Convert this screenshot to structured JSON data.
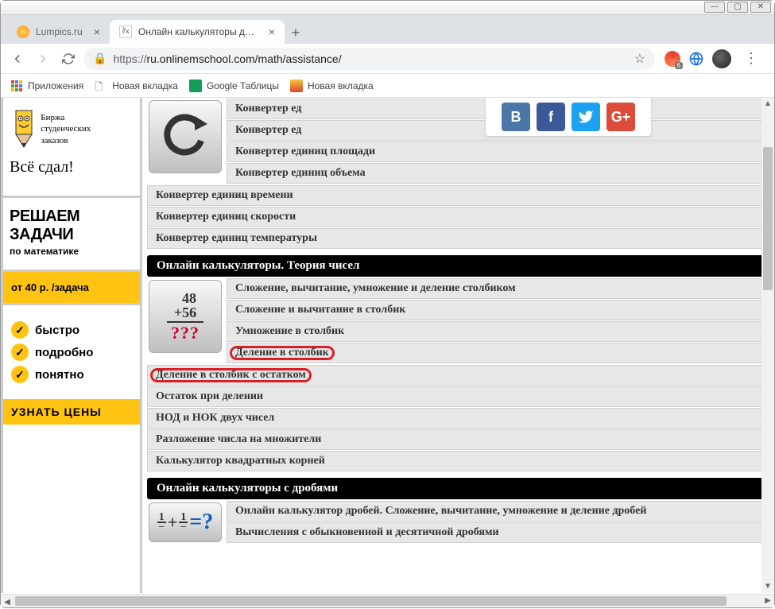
{
  "window": {
    "controls": {
      "min": "—",
      "max": "▢",
      "close": "✕"
    }
  },
  "tabs": {
    "items": [
      {
        "title": "Lumpics.ru"
      },
      {
        "title": "Онлайн калькуляторы для реше"
      }
    ],
    "newTab": "+"
  },
  "toolbar": {
    "proto": "https://",
    "url": "ru.onlinemschool.com/math/assistance/",
    "badge": "6"
  },
  "bookmarks": {
    "apps": "Приложения",
    "items": [
      "Новая вкладка",
      "Google Таблицы",
      "Новая вкладка"
    ]
  },
  "ads": {
    "ad1": {
      "line1": "Биржа",
      "line2": "студенческих",
      "line3": "заказов",
      "slogan": "Всё сдал!"
    },
    "ad2": {
      "l1": "РЕШАЕМ",
      "l2": "ЗАДАЧИ",
      "l3": "по математике"
    },
    "ad3": "от 40 р. /задача",
    "ad4": [
      "быстро",
      "подробно",
      "понятно"
    ],
    "ad5": "УЗНАТЬ ЦЕНЫ"
  },
  "social": {
    "vk": "B",
    "fb": "f",
    "tw": "t",
    "gp": "G+"
  },
  "sections": {
    "conv": {
      "items_side": [
        "Конвертер ед",
        "Конвертер ед",
        "Конвертер единиц площади",
        "Конвертер единиц объема"
      ],
      "items_full": [
        "Конвертер единиц времени",
        "Конвертер единиц скорости",
        "Конвертер единиц температуры"
      ]
    },
    "numtheory": {
      "title": "Онлайн калькуляторы. Теория чисел",
      "icon": {
        "top": "48",
        "plus": "+56",
        "q": "???"
      },
      "items_side": [
        "Сложение, вычитание, умножение и деление столбиком",
        "Сложение и вычитание в столбик",
        "Умножение в столбик",
        "Деление в столбик"
      ],
      "items_full": [
        "Деление в столбик с остатком",
        "Остаток при делении",
        "НОД и НОК двух чисел",
        "Разложение числа на множители",
        "Калькулятор квадратных корней"
      ]
    },
    "frac": {
      "title": "Онлайн калькуляторы с дробями",
      "items_side": [
        "Онлайн калькулятор дробей. Сложение, вычитание, умножение и деление дробей",
        "Вычисления с обыкновенной и десятичной дробями"
      ]
    }
  }
}
